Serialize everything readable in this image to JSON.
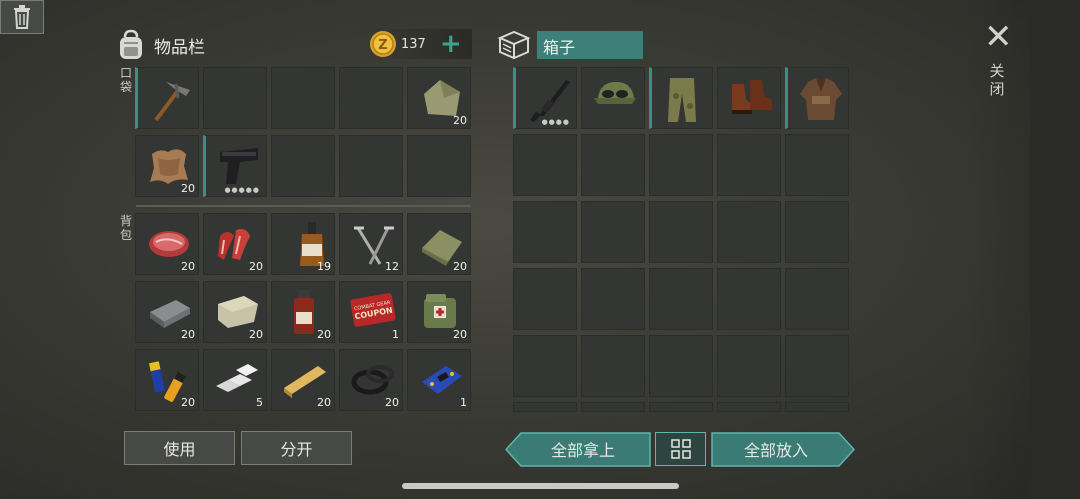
{
  "inventory": {
    "title": "物品栏",
    "coins": "137",
    "section_pocket": "口袋",
    "section_backpack": "背包",
    "pocket_slots": [
      {
        "name": "pickaxe",
        "qty": "",
        "icon": "pickaxe-icon"
      },
      {
        "name": "empty",
        "qty": ""
      },
      {
        "name": "empty",
        "qty": ""
      },
      {
        "name": "empty",
        "qty": ""
      },
      {
        "name": "cloth",
        "qty": "20",
        "icon": "cloth-icon"
      },
      {
        "name": "leather",
        "qty": "20",
        "icon": "leather-icon"
      },
      {
        "name": "pistol",
        "qty": "",
        "icon": "pistol-icon"
      },
      {
        "name": "empty",
        "qty": ""
      },
      {
        "name": "empty",
        "qty": ""
      },
      {
        "name": "empty",
        "qty": ""
      }
    ],
    "backpack_slots": [
      {
        "name": "meat",
        "qty": "20"
      },
      {
        "name": "bacon",
        "qty": "20"
      },
      {
        "name": "whiskey",
        "qty": "19"
      },
      {
        "name": "nails",
        "qty": "12"
      },
      {
        "name": "fabric",
        "qty": "20"
      },
      {
        "name": "iron-ingot",
        "qty": "20"
      },
      {
        "name": "stone",
        "qty": "20"
      },
      {
        "name": "bottle",
        "qty": "20"
      },
      {
        "name": "coupon",
        "qty": "1"
      },
      {
        "name": "medkit",
        "qty": "20"
      },
      {
        "name": "batteries",
        "qty": "20"
      },
      {
        "name": "aluminum-bars",
        "qty": "5"
      },
      {
        "name": "plank",
        "qty": "20"
      },
      {
        "name": "rubber-rings",
        "qty": "20"
      },
      {
        "name": "circuit-board",
        "qty": "1"
      }
    ],
    "coupon_text_1": "COMBAT GEAR",
    "coupon_text_2": "COUPON"
  },
  "box": {
    "title": "箱子",
    "items": [
      "rifle",
      "hat",
      "pants",
      "boots",
      "jacket"
    ]
  },
  "buttons": {
    "use": "使用",
    "split": "分开",
    "take_all": "全部拿上",
    "put_all": "全部放入",
    "close": "关闭"
  },
  "colors": {
    "accent": "#3d8e83",
    "slot_bg": "#343633"
  }
}
